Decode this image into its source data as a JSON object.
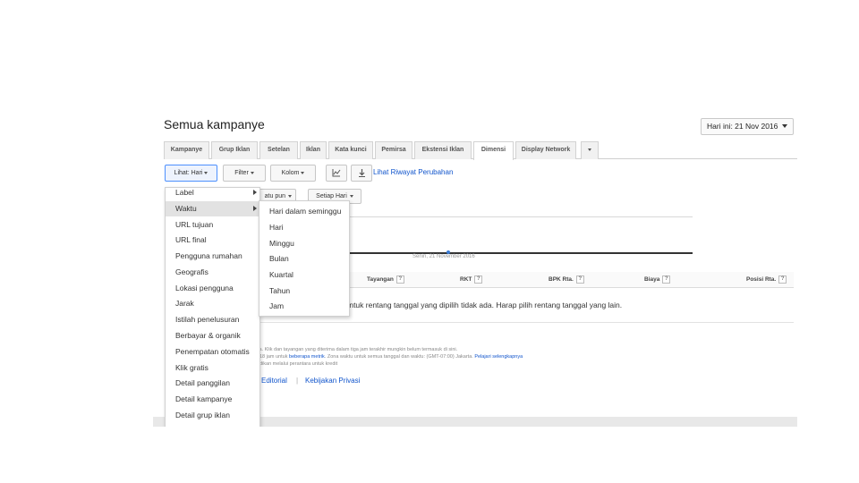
{
  "page": {
    "title": "Semua kampanye"
  },
  "date_range": {
    "label": "Hari ini: 21 Nov 2016"
  },
  "tabs": [
    {
      "label": "Kampanye"
    },
    {
      "label": "Grup Iklan"
    },
    {
      "label": "Setelan"
    },
    {
      "label": "Iklan"
    },
    {
      "label": "Kata kunci"
    },
    {
      "label": "Pemirsa"
    },
    {
      "label": "Ekstensi Iklan"
    },
    {
      "label": "Dimensi"
    },
    {
      "label": "Display Network"
    }
  ],
  "active_tab": "Dimensi",
  "toolbar": {
    "view_label": "Lihat: Hari",
    "filter_label": "Filter",
    "columns_label": "Kolom",
    "chart_icon": "line-chart-icon",
    "download_icon": "download-icon",
    "history_link": "Lihat Riwayat Perubahan"
  },
  "secondary_toolbar": {
    "segment_label": "atu pun",
    "setiap_label": "Setiap Hari"
  },
  "chart": {
    "date_label": "Senin, 21 November 2016"
  },
  "table": {
    "headers": [
      "Tayangan",
      "RKT",
      "BPK Rta.",
      "Biaya",
      "Posisi Rta."
    ],
    "empty_message": "k untuk rentang tanggal yang dipilih tidak ada. Harap pilih rentang tanggal yang lain."
  },
  "footer": {
    "line1": "ta. Klik dan tayangan yang diterima dalam tiga jam terakhir mungkin belum termasuk di sini.",
    "line2_prefix": "18 jam untuk",
    "line2_link1": "beberapa metrik",
    "line2_middle": ". Zona waktu untuk semua tanggal dan waktu: (GMT-07:00) Jakarta.",
    "line2_link2": "Pelajari selengkapnya",
    "line3": "dikan melalui perantara untuk kredit",
    "links": [
      "Editorial",
      "Kebijakan Privasi"
    ]
  },
  "view_menu": {
    "items": [
      {
        "label": "Label",
        "has_submenu": true
      },
      {
        "label": "Waktu",
        "has_submenu": true
      },
      {
        "label": "URL tujuan"
      },
      {
        "label": "URL final"
      },
      {
        "label": "Pengguna rumahan"
      },
      {
        "label": "Geografis"
      },
      {
        "label": "Lokasi pengguna"
      },
      {
        "label": "Jarak"
      },
      {
        "label": "Istilah penelusuran"
      },
      {
        "label": "Berbayar & organik"
      },
      {
        "label": "Penempatan otomatis"
      },
      {
        "label": "Klik gratis"
      },
      {
        "label": "Detail panggilan"
      },
      {
        "label": "Detail kampanye"
      },
      {
        "label": "Detail grup iklan"
      }
    ],
    "highlighted": "Waktu"
  },
  "time_submenu": {
    "items": [
      {
        "label": "Hari dalam seminggu"
      },
      {
        "label": "Hari"
      },
      {
        "label": "Minggu"
      },
      {
        "label": "Bulan"
      },
      {
        "label": "Kuartal"
      },
      {
        "label": "Tahun"
      },
      {
        "label": "Jam"
      }
    ]
  },
  "colors": {
    "link": "#1155cc",
    "selected_border": "#4d90fe",
    "chart_line": "#333333",
    "chart_point": "#3a7bd5"
  }
}
